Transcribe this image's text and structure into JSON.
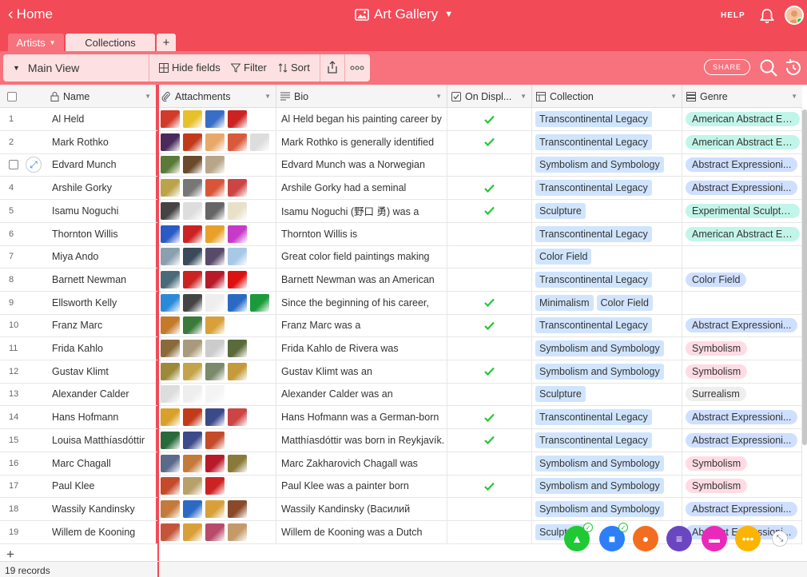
{
  "topbar": {
    "home_label": "Home",
    "app_title": "Art Gallery",
    "help_label": "HELP"
  },
  "tabs": [
    {
      "label": "Artists"
    },
    {
      "label": "Collections"
    },
    {
      "label": "+"
    }
  ],
  "viewbar": {
    "view_name": "Main View",
    "hide_fields": "Hide fields",
    "filter": "Filter",
    "sort": "Sort",
    "share": "SHARE"
  },
  "columns": {
    "name": "Name",
    "attachments": "Attachments",
    "bio": "Bio",
    "on_display": "On Displ...",
    "collection": "Collection",
    "genre": "Genre"
  },
  "colors": {
    "brand": "#f24a57",
    "brand_light": "#f7727c",
    "check": "#20c933"
  },
  "rows": [
    {
      "num": "1",
      "name": "Al Held",
      "bio": "Al Held began his painting career by",
      "on_display": true,
      "collection": [
        "Transcontinental Legacy"
      ],
      "genre": "American Abstract Ex...",
      "genre_class": "g-aae",
      "thumbs": [
        "#d23a2a",
        "#e6c12a",
        "#3a6ec4",
        "#c22"
      ]
    },
    {
      "num": "2",
      "name": "Mark Rothko",
      "bio": "Mark Rothko is generally identified",
      "on_display": true,
      "collection": [
        "Transcontinental Legacy"
      ],
      "genre": "American Abstract Ex...",
      "genre_class": "g-aae",
      "thumbs": [
        "#4a2a5a",
        "#c23a1a",
        "#e8a86a",
        "#d95a3a",
        "#ddd"
      ]
    },
    {
      "num": "3",
      "name": "Edvard Munch",
      "bio": "Edvard Munch was a Norwegian",
      "on_display": false,
      "collection": [
        "Symbolism and Symbology"
      ],
      "genre": "Abstract Expressioni...",
      "genre_class": "g-ae",
      "thumbs": [
        "#5a7a3a",
        "#6a4a2a",
        "#b9a58a"
      ]
    },
    {
      "num": "4",
      "name": "Arshile Gorky",
      "bio": "Arshile Gorky had a seminal",
      "on_display": true,
      "collection": [
        "Transcontinental Legacy"
      ],
      "genre": "Abstract Expressioni...",
      "genre_class": "g-ae",
      "thumbs": [
        "#b9a44a",
        "#777",
        "#d9553a",
        "#c44"
      ]
    },
    {
      "num": "5",
      "name": "Isamu Noguchi",
      "bio": "Isamu Noguchi (野口 勇) was a",
      "on_display": true,
      "collection": [
        "Sculpture"
      ],
      "genre": "Experimental Sculpture",
      "genre_class": "g-es",
      "thumbs": [
        "#444",
        "#ddd",
        "#666",
        "#e8e0c8"
      ]
    },
    {
      "num": "6",
      "name": "Thornton Willis",
      "bio": "Thornton Willis is",
      "on_display": false,
      "collection": [
        "Transcontinental Legacy"
      ],
      "genre": "American Abstract Ex...",
      "genre_class": "g-aae",
      "thumbs": [
        "#2a5ac4",
        "#c22",
        "#e8a02a",
        "#c73ac7"
      ]
    },
    {
      "num": "7",
      "name": "Miya Ando",
      "bio": "Great color field paintings making",
      "on_display": false,
      "collection": [
        "Color Field"
      ],
      "genre": "",
      "genre_class": "",
      "thumbs": [
        "#8aa0b0",
        "#3a4a5a",
        "#5a4a6a",
        "#a8c8e8"
      ]
    },
    {
      "num": "8",
      "name": "Barnett Newman",
      "bio": "Barnett Newman was an American",
      "on_display": false,
      "collection": [
        "Transcontinental Legacy"
      ],
      "genre": "Color Field",
      "genre_class": "g-cf",
      "thumbs": [
        "#4a6a7a",
        "#c22",
        "#b81a2a",
        "#d11"
      ]
    },
    {
      "num": "9",
      "name": "Ellsworth Kelly",
      "bio": "Since the beginning of his career,",
      "on_display": true,
      "collection": [
        "Minimalism",
        "Color Field"
      ],
      "genre": "",
      "genre_class": "",
      "thumbs": [
        "#2a8ad9",
        "#444",
        "#eee",
        "#2a6ac4",
        "#1a9a3a"
      ]
    },
    {
      "num": "10",
      "name": "Franz Marc",
      "bio": "Franz Marc was a",
      "on_display": true,
      "collection": [
        "Transcontinental Legacy"
      ],
      "genre": "Abstract Expressioni...",
      "genre_class": "g-ae",
      "thumbs": [
        "#c47a2a",
        "#3a7a3a",
        "#d9a03a"
      ]
    },
    {
      "num": "11",
      "name": "Frida Kahlo",
      "bio": "Frida Kahlo de Rivera was",
      "on_display": false,
      "collection": [
        "Symbolism and Symbology"
      ],
      "genre": "Symbolism",
      "genre_class": "g-sym",
      "thumbs": [
        "#8a6a3a",
        "#a89a7a",
        "#ccc",
        "#5a6a3a"
      ]
    },
    {
      "num": "12",
      "name": "Gustav Klimt",
      "bio": "Gustav Klimt was an",
      "on_display": true,
      "collection": [
        "Symbolism and Symbology"
      ],
      "genre": "Symbolism",
      "genre_class": "g-sym",
      "thumbs": [
        "#9a8a3a",
        "#c4a44a",
        "#7a8a6a",
        "#c49a3a"
      ]
    },
    {
      "num": "13",
      "name": "Alexander Calder",
      "bio": "Alexander Calder was an",
      "on_display": false,
      "collection": [
        "Sculpture"
      ],
      "genre": "Surrealism",
      "genre_class": "g-sur",
      "thumbs": [
        "#ddd",
        "#eee",
        "#f4f4f4"
      ]
    },
    {
      "num": "14",
      "name": "Hans Hofmann",
      "bio": "Hans Hofmann was a German-born",
      "on_display": true,
      "collection": [
        "Transcontinental Legacy"
      ],
      "genre": "Abstract Expressioni...",
      "genre_class": "g-ae",
      "thumbs": [
        "#d9a02a",
        "#c23a1a",
        "#3a4a8a",
        "#c44"
      ]
    },
    {
      "num": "15",
      "name": "Louisa Matthíasdóttir",
      "bio": "Matthíasdóttir was born in Reykjavík.",
      "on_display": true,
      "collection": [
        "Transcontinental Legacy"
      ],
      "genre": "Abstract Expressioni...",
      "genre_class": "g-ae",
      "thumbs": [
        "#2a6a3a",
        "#3a4a8a",
        "#c44a2a"
      ]
    },
    {
      "num": "16",
      "name": "Marc Chagall",
      "bio": "Marc Zakharovich Chagall was",
      "on_display": false,
      "collection": [
        "Symbolism and Symbology"
      ],
      "genre": "Symbolism",
      "genre_class": "g-sym",
      "thumbs": [
        "#5a6a8a",
        "#c47a3a",
        "#b81a2a",
        "#8a7a3a"
      ]
    },
    {
      "num": "17",
      "name": "Paul Klee",
      "bio": "Paul Klee was a painter born",
      "on_display": true,
      "collection": [
        "Symbolism and Symbology"
      ],
      "genre": "Symbolism",
      "genre_class": "g-sym",
      "thumbs": [
        "#c44a2a",
        "#b8a06a",
        "#c22"
      ]
    },
    {
      "num": "18",
      "name": "Wassily Kandinsky",
      "bio": "Wassily Kandinsky (Василий",
      "on_display": false,
      "collection": [
        "Symbolism and Symbology"
      ],
      "genre": "Abstract Expressioni...",
      "genre_class": "g-ae",
      "thumbs": [
        "#c47a3a",
        "#2a6ac4",
        "#d9a03a",
        "#8a4a2a"
      ]
    },
    {
      "num": "19",
      "name": "Willem de Kooning",
      "bio": "Willem de Kooning was a Dutch",
      "on_display": false,
      "collection": [
        "Sculpture"
      ],
      "genre": "Abstract Expressioni...",
      "genre_class": "g-ae",
      "thumbs": [
        "#c4553a",
        "#d9a03a",
        "#b84a6a",
        "#c49a6a"
      ]
    }
  ],
  "footer": {
    "record_count": "19 records"
  },
  "apps": [
    {
      "icon": "chart-app-icon",
      "color": "#20c933"
    },
    {
      "icon": "blocks-app-icon",
      "color": "#2d7ff9"
    },
    {
      "icon": "person-app-icon",
      "color": "#f36d21"
    },
    {
      "icon": "list-app-icon",
      "color": "#6b46c1"
    },
    {
      "icon": "comment-app-icon",
      "color": "#e929ba"
    },
    {
      "icon": "more-app-icon",
      "color": "#fcb400"
    }
  ]
}
